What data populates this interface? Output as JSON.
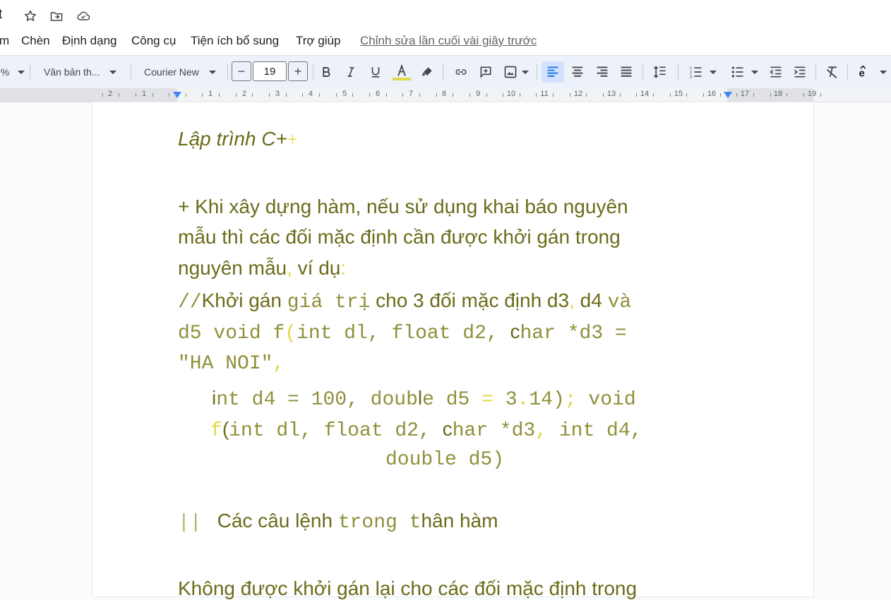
{
  "window": {
    "title_fragment": "t"
  },
  "title_icons": [
    "star-icon",
    "move-to-folder-icon",
    "cloud-status-icon"
  ],
  "menu": {
    "items": [
      "m",
      "Chèn",
      "Định dạng",
      "Công cụ",
      "Tiện ích bổ sung",
      "Trợ giúp"
    ],
    "last_edit": "Chỉnh sửa lần cuối vài giây trước"
  },
  "toolbar": {
    "zoom": "%",
    "style": "Văn bản th...",
    "font": "Courier New",
    "size": "19",
    "minus": "−",
    "plus": "+"
  },
  "ruler": {
    "numbers": [
      "2",
      "1",
      "1",
      "2",
      "3",
      "4",
      "5",
      "6",
      "7",
      "8",
      "9",
      "10",
      "11",
      "12",
      "13",
      "14",
      "15",
      "16",
      "17",
      "18",
      "19"
    ]
  },
  "doc": {
    "title": "Lập trình C+",
    "title_plus": "+",
    "p1_line1": "+ Khi xây dựng hàm, nếu sử dụng khai báo nguyên",
    "p1_line2": "mẫu thì các đối mặc định cần được khởi gán trong",
    "p1_line3a": "nguyên mẫu",
    "p1_line3b": ",",
    "p1_line3c": " ví dụ",
    "p1_line3d": ":",
    "c1_a": "//",
    "c1_b": "Khởi gán ",
    "c1_c": "giá trị",
    "c1_d": "  cho 3 đối mặc định d3",
    "c1_e": ",",
    "c1_f": " d4 ",
    "c1_g": "và",
    "c2_a": "d5 void f",
    "c2_b": "(",
    "c2_c": "int dl, float d2, ",
    "c2_d": "c",
    "c2_e": "har *d3 =",
    "c3_a": "\"HA NOI\"",
    "c3_b": ",",
    "c4_a": "i",
    "c4_b": "nt d4 = 100, doub",
    "c4_c": "l",
    "c4_d": "e d5 ",
    "c4_e": "=",
    "c4_f": " 3",
    "c4_g": ".",
    "c4_h": "14)",
    "c4_i": ";",
    "c4_j": " void",
    "c5_a": "f",
    "c5_b": "(",
    "c5_c": "int dl, float d2, ",
    "c5_d": "c",
    "c5_e": "har *d3",
    "c5_f": ",",
    "c5_g": " int d4,",
    "c6": "double d5)",
    "s1_a": "||",
    "s1_b": "Các câu lệnh ",
    "s1_c": "trong t",
    "s1_d": "hân hàm",
    "last": "Không được khởi gán lại cho các đối mặc định trong"
  },
  "colors": {
    "text_olive": "#6b6b1a",
    "mono_olive": "#8f8f3a",
    "yellow": "#e1d84a",
    "toolbar_bg": "#edf2fa",
    "accent_blue": "#1a73e8"
  }
}
